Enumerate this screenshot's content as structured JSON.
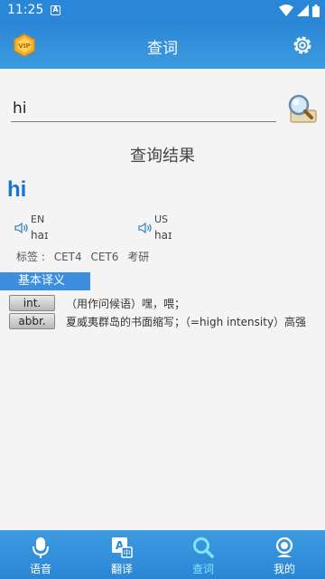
{
  "status_bar": {
    "time": "11:25",
    "notification_letter": "A"
  },
  "header": {
    "title": "查词"
  },
  "search": {
    "value": "hi",
    "placeholder": ""
  },
  "result": {
    "title": "查询结果",
    "word": "hi",
    "pronunciations": [
      {
        "label": "EN",
        "ipa": "haɪ"
      },
      {
        "label": "US",
        "ipa": "haɪ"
      }
    ],
    "tags_label": "标签 :",
    "tags": [
      "CET4",
      "CET6",
      "考研"
    ],
    "section_title": "基本译义",
    "definitions": [
      {
        "pos": "int.",
        "meaning": "（用作问候语）嘿，喂；"
      },
      {
        "pos": "abbr.",
        "meaning": "夏威夷群岛的书面缩写；（=high intensity）高强"
      }
    ]
  },
  "bottom_nav": [
    {
      "label": "语音",
      "icon": "microphone-icon"
    },
    {
      "label": "翻译",
      "icon": "translate-icon"
    },
    {
      "label": "查词",
      "icon": "search-icon"
    },
    {
      "label": "我的",
      "icon": "profile-icon"
    }
  ],
  "colors": {
    "primary": "#2a86d6",
    "accent": "#1a73d6",
    "active_tab": "#7fe8ff"
  }
}
